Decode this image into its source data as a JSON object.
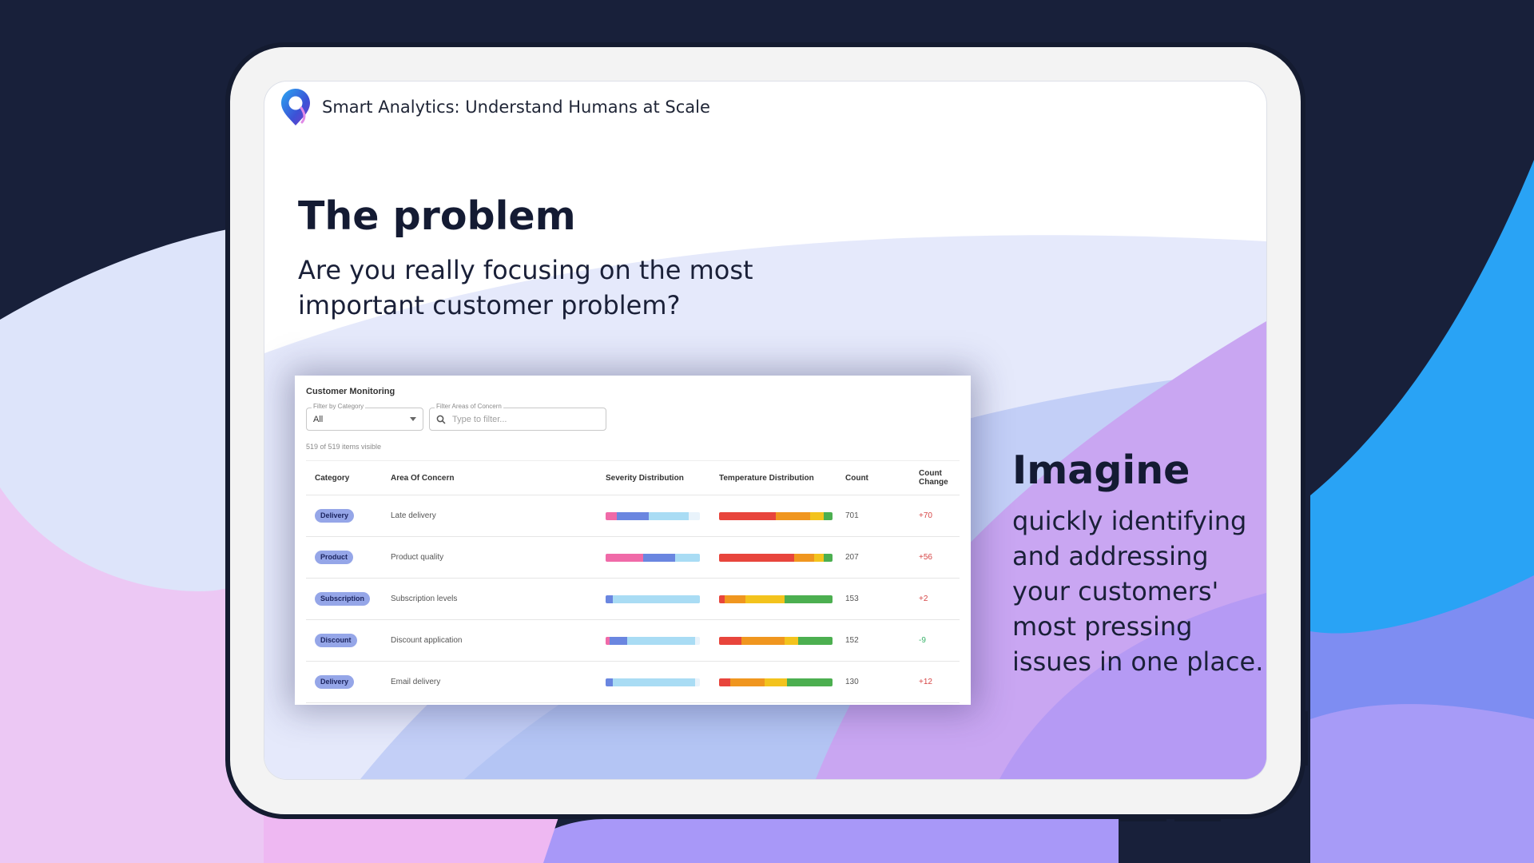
{
  "app": {
    "title": "Smart Analytics: Understand Humans at Scale",
    "logo_icon": "location-pin-logo"
  },
  "problem": {
    "heading": "The problem",
    "text": "Are you really focusing on the most important customer problem?"
  },
  "imagine": {
    "heading": "Imagine",
    "text": "quickly identifying and addressing your customers' most pressing issues in one place."
  },
  "dashboard": {
    "title": "Customer Monitoring",
    "category_filter": {
      "label": "Filter by Category",
      "value": "All"
    },
    "concern_filter": {
      "label": "Filter Areas of Concern",
      "placeholder": "Type to filter..."
    },
    "visible_count": "519 of 519 items visible",
    "columns": [
      "Category",
      "Area Of Concern",
      "Severity Distribution",
      "Temperature Distribution",
      "Count",
      "Count Change"
    ],
    "severity_colors": [
      "#f06aa8",
      "#6a86e0",
      "#a9dcf4"
    ],
    "temperature_colors": [
      "#e8453c",
      "#f0961f",
      "#f3c31d",
      "#4caf50"
    ],
    "rows": [
      {
        "category": "Delivery",
        "area": "Late delivery",
        "count": "701",
        "change": "+70",
        "trend": "up",
        "severity": [
          0.12,
          0.34,
          0.42
        ],
        "temperature": [
          0.5,
          0.3,
          0.12,
          0.08
        ]
      },
      {
        "category": "Product",
        "area": "Product quality",
        "count": "207",
        "change": "+56",
        "trend": "up",
        "severity": [
          0.4,
          0.34,
          0.26
        ],
        "temperature": [
          0.66,
          0.18,
          0.08,
          0.08
        ]
      },
      {
        "category": "Subscription",
        "area": "Subscription levels",
        "count": "153",
        "change": "+2",
        "trend": "up",
        "severity": [
          0,
          0.08,
          0.92
        ],
        "temperature": [
          0.05,
          0.18,
          0.35,
          0.42
        ]
      },
      {
        "category": "Discount",
        "area": "Discount application",
        "count": "152",
        "change": "-9",
        "trend": "down",
        "severity": [
          0.04,
          0.19,
          0.72
        ],
        "temperature": [
          0.2,
          0.38,
          0.12,
          0.3
        ]
      },
      {
        "category": "Delivery",
        "area": "Email delivery",
        "count": "130",
        "change": "+12",
        "trend": "up",
        "severity": [
          0,
          0.08,
          0.87
        ],
        "temperature": [
          0.1,
          0.3,
          0.2,
          0.4
        ]
      }
    ]
  }
}
